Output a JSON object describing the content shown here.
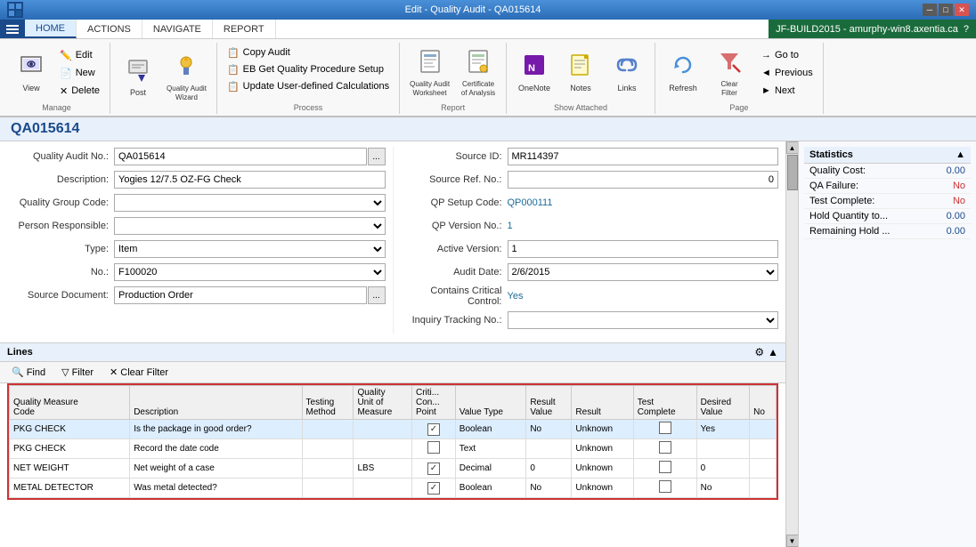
{
  "titleBar": {
    "title": "Edit - Quality Audit - QA015614",
    "logo": "M",
    "minBtn": "─",
    "maxBtn": "□",
    "closeBtn": "✕"
  },
  "menuBar": {
    "tabs": [
      {
        "id": "home",
        "label": "HOME",
        "active": true
      },
      {
        "id": "actions",
        "label": "ACTIONS",
        "active": false
      },
      {
        "id": "navigate",
        "label": "NAVIGATE",
        "active": false
      },
      {
        "id": "report",
        "label": "REPORT",
        "active": false
      }
    ],
    "userBadge": "JF-BUILD2015 - amurphy-win8.axentia.ca",
    "helpIcon": "?"
  },
  "ribbon": {
    "groups": [
      {
        "id": "manage",
        "label": "Manage",
        "buttons": [
          {
            "id": "view",
            "icon": "👁",
            "label": "View"
          },
          {
            "id": "new",
            "icon": "📄",
            "label": "New"
          },
          {
            "id": "delete",
            "icon": "✕",
            "label": "Delete"
          }
        ]
      },
      {
        "id": "post",
        "label": "",
        "buttons": [
          {
            "id": "post",
            "icon": "📮",
            "label": "Post"
          },
          {
            "id": "quality-audit-wizard",
            "icon": "🧙",
            "label": "Quality Audit\nWizard"
          }
        ]
      },
      {
        "id": "process",
        "label": "Process",
        "small_buttons": [
          {
            "id": "copy-audit",
            "icon": "📋",
            "label": "Copy Audit"
          },
          {
            "id": "get-quality-procedure-setup",
            "icon": "📋",
            "label": "EB Get Quality Procedure Setup"
          },
          {
            "id": "update-user-defined",
            "icon": "📋",
            "label": "Update User-defined Calculations"
          }
        ]
      },
      {
        "id": "report-group",
        "label": "Report",
        "buttons": [
          {
            "id": "quality-audit-worksheet",
            "icon": "📊",
            "label": "Quality Audit\nWorksheet"
          },
          {
            "id": "certificate-of-analysis",
            "icon": "📊",
            "label": "Certificate\nof Analysis"
          }
        ]
      },
      {
        "id": "show-attached",
        "label": "Show Attached",
        "buttons": [
          {
            "id": "onenote",
            "icon": "🗒",
            "label": "OneNote"
          },
          {
            "id": "notes",
            "icon": "📝",
            "label": "Notes"
          },
          {
            "id": "links",
            "icon": "🔗",
            "label": "Links"
          }
        ]
      },
      {
        "id": "page-group",
        "label": "Page",
        "buttons": [
          {
            "id": "refresh",
            "icon": "🔄",
            "label": "Refresh"
          },
          {
            "id": "clear-filter",
            "icon": "🔽",
            "label": "Clear\nFilter"
          }
        ],
        "small_nav": [
          {
            "id": "goto",
            "label": "Go to"
          },
          {
            "id": "previous",
            "label": "◄ Previous"
          },
          {
            "id": "next",
            "label": "Next"
          }
        ]
      }
    ]
  },
  "pageHeader": {
    "id": "QA015614"
  },
  "form": {
    "leftFields": [
      {
        "label": "Quality Audit No.:",
        "value": "QA015614",
        "type": "input-btn",
        "id": "quality-audit-no"
      },
      {
        "label": "Description:",
        "value": "Yogies 12/7.5 OZ-FG Check",
        "type": "input",
        "id": "description"
      },
      {
        "label": "Quality Group Code:",
        "value": "",
        "type": "select",
        "id": "quality-group-code"
      },
      {
        "label": "Person Responsible:",
        "value": "",
        "type": "select",
        "id": "person-responsible"
      },
      {
        "label": "Type:",
        "value": "Item",
        "type": "select",
        "id": "type"
      },
      {
        "label": "No.:",
        "value": "F100020",
        "type": "select",
        "id": "no"
      },
      {
        "label": "Source Document:",
        "value": "Production Order",
        "type": "input-btn",
        "id": "source-document"
      }
    ],
    "rightFields": [
      {
        "label": "Source ID:",
        "value": "MR114397",
        "type": "input",
        "id": "source-id"
      },
      {
        "label": "Source Ref. No.:",
        "value": "0",
        "type": "input",
        "id": "source-ref-no",
        "align": "right"
      },
      {
        "label": "QP Setup Code:",
        "value": "QP000111",
        "type": "link",
        "id": "qp-setup-code"
      },
      {
        "label": "QP Version No.:",
        "value": "1",
        "type": "link",
        "id": "qp-version-no"
      },
      {
        "label": "Active Version:",
        "value": "1",
        "type": "input",
        "id": "active-version"
      },
      {
        "label": "Audit Date:",
        "value": "2/6/2015",
        "type": "select",
        "id": "audit-date"
      },
      {
        "label": "Contains Critical Control:",
        "value": "Yes",
        "type": "static",
        "id": "contains-critical-control"
      },
      {
        "label": "Inquiry Tracking No.:",
        "value": "",
        "type": "select",
        "id": "inquiry-tracking-no"
      }
    ]
  },
  "lines": {
    "title": "Lines",
    "toolbar": [
      {
        "id": "find",
        "icon": "🔍",
        "label": "Find"
      },
      {
        "id": "filter",
        "icon": "▽",
        "label": "Filter"
      },
      {
        "id": "clear-filter",
        "icon": "✕",
        "label": "Clear Filter"
      }
    ],
    "columns": [
      {
        "id": "quality-measure-code",
        "label": "Quality Measure\nCode"
      },
      {
        "id": "description",
        "label": "Description"
      },
      {
        "id": "testing-method",
        "label": "Testing\nMethod"
      },
      {
        "id": "quality-unit-of-measure",
        "label": "Quality\nUnit of\nMeasure"
      },
      {
        "id": "critical-control-point",
        "label": "Criti...\nCon...\nPoint"
      },
      {
        "id": "value-type",
        "label": "Value Type"
      },
      {
        "id": "result-value",
        "label": "Result\nValue"
      },
      {
        "id": "result",
        "label": "Result"
      },
      {
        "id": "test-complete",
        "label": "Test\nComplete"
      },
      {
        "id": "desired-value",
        "label": "Desired\nValue"
      },
      {
        "id": "no-col",
        "label": "No"
      }
    ],
    "rows": [
      {
        "quality-measure-code": "PKG CHECK",
        "description": "Is the package in good order?",
        "testing-method": "",
        "quality-unit-of-measure": "",
        "critical-control-point": true,
        "value-type": "Boolean",
        "result-value": "No",
        "result": "Unknown",
        "test-complete": false,
        "desired-value": "Yes",
        "no-col": "",
        "selected": true
      },
      {
        "quality-measure-code": "PKG CHECK",
        "description": "Record the date code",
        "testing-method": "",
        "quality-unit-of-measure": "",
        "critical-control-point": false,
        "value-type": "Text",
        "result-value": "",
        "result": "Unknown",
        "test-complete": false,
        "desired-value": "",
        "no-col": "",
        "selected": false
      },
      {
        "quality-measure-code": "NET WEIGHT",
        "description": "Net weight of a case",
        "testing-method": "",
        "quality-unit-of-measure": "LBS",
        "critical-control-point": true,
        "value-type": "Decimal",
        "result-value": "0",
        "result": "Unknown",
        "test-complete": false,
        "desired-value": "0",
        "no-col": "",
        "selected": false
      },
      {
        "quality-measure-code": "METAL DETECTOR",
        "description": "Was metal detected?",
        "testing-method": "",
        "quality-unit-of-measure": "",
        "critical-control-point": true,
        "value-type": "Boolean",
        "result-value": "No",
        "result": "Unknown",
        "test-complete": false,
        "desired-value": "No",
        "no-col": "",
        "selected": false
      }
    ]
  },
  "statistics": {
    "title": "Statistics",
    "items": [
      {
        "label": "Quality Cost:",
        "value": "0.00",
        "color": "blue"
      },
      {
        "label": "QA Failure:",
        "value": "No",
        "color": "red"
      },
      {
        "label": "Test Complete:",
        "value": "No",
        "color": "red"
      },
      {
        "label": "Hold Quantity to...",
        "value": "0.00",
        "color": "blue"
      },
      {
        "label": "Remaining Hold ...",
        "value": "0.00",
        "color": "blue"
      }
    ]
  }
}
